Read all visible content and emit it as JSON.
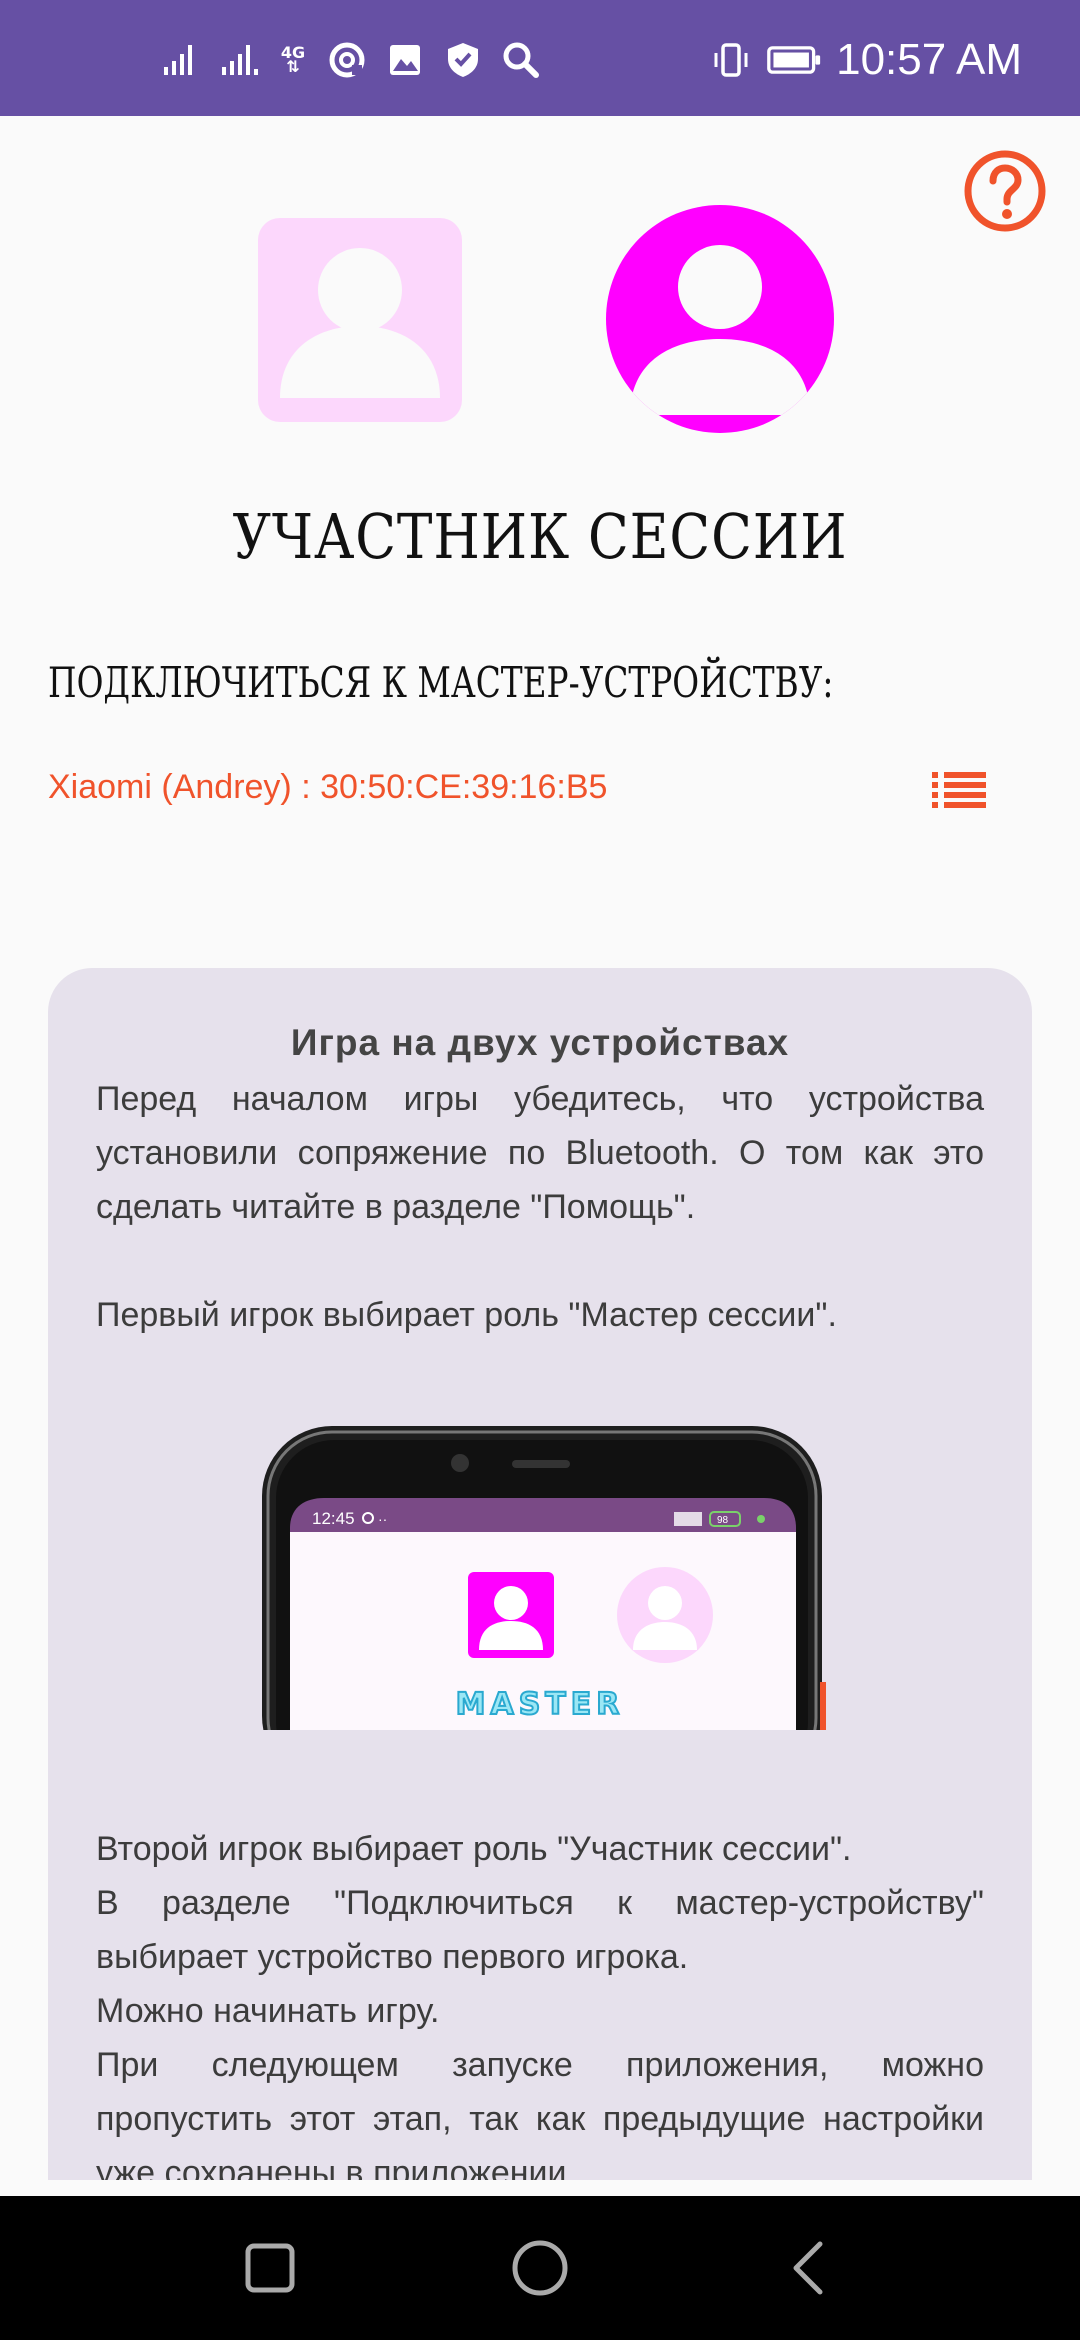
{
  "status_bar": {
    "time": "10:57 AM",
    "network_label": "4G",
    "background_color": "#6650a4",
    "icons": [
      "signal-icon",
      "signal-icon-2",
      "mobile-data-icon",
      "sync-icon",
      "image-icon",
      "shield-icon",
      "search-icon",
      "vibrate-icon",
      "battery-icon"
    ]
  },
  "help": {
    "icon": "help-icon",
    "color": "#f0532b"
  },
  "roles": {
    "master_icon": "person-square-icon",
    "participant_icon": "person-circle-icon",
    "selected_color": "#ff00ff",
    "unselected_color": "#fcd7fc",
    "title": "УЧАСТНИК СЕССИИ"
  },
  "connection": {
    "label": "ПОДКЛЮЧИТЬСЯ К МАСТЕР-УСТРОЙСТВУ:",
    "device": "Xiaomi (Andrey) : 30:50:CE:39:16:B5",
    "device_color": "#f0532b",
    "list_icon": "list-icon"
  },
  "info": {
    "title": "Игра на двух устройствах",
    "paragraph1": "Перед началом игры убедитесь, что устройства установили сопряжение по Bluetooth. О том как это сделать читайте в разделе \"Помощь\".",
    "paragraph2": "Первый игрок выбирает роль \"Мастер сессии\".",
    "paragraph3_lines": [
      "Второй игрок выбирает роль \"Участник сессии\".",
      "В разделе \"Подключиться к мастер-устройству\" выбирает устройство первого игрока.",
      "Можно начинать игру.",
      "При следующем запуске приложения, можно пропустить этот этап, так как предыдущие настройки уже сохранены в приложении."
    ],
    "illustration": {
      "time": "12:45",
      "battery": "98",
      "caption": "MASTER"
    }
  },
  "nav": {
    "recents_icon": "recents-icon",
    "home_icon": "home-icon",
    "back_icon": "back-icon"
  }
}
